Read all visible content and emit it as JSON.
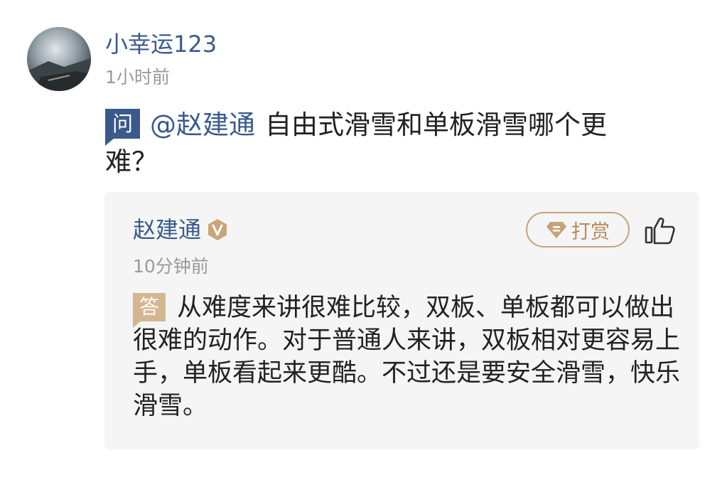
{
  "asker": {
    "avatar": "avatar-photo",
    "name": "小幸运123",
    "time": "1小时前"
  },
  "question": {
    "badge": "问",
    "mention": "@赵建通",
    "text": "自由式滑雪和单板滑雪哪个更难？"
  },
  "answer": {
    "author": "赵建通",
    "verified_icon": "verified-v-icon",
    "tip_label": "打赏",
    "tip_icon": "gem-icon",
    "like_icon": "thumbs-up-icon",
    "time": "10分钟前",
    "badge": "答",
    "text": "从难度来讲很难比较，双板、单板都可以做出很难的动作。对于普通人来讲，双板相对更容易上手，单板看起来更酷。不过还是要安全滑雪，快乐滑雪。"
  },
  "colors": {
    "accent_blue": "#3a5a8c",
    "gold": "#c8a27a",
    "answer_badge": "#d4b690",
    "muted": "#9a9a9a",
    "card_bg": "#f5f5f5"
  }
}
